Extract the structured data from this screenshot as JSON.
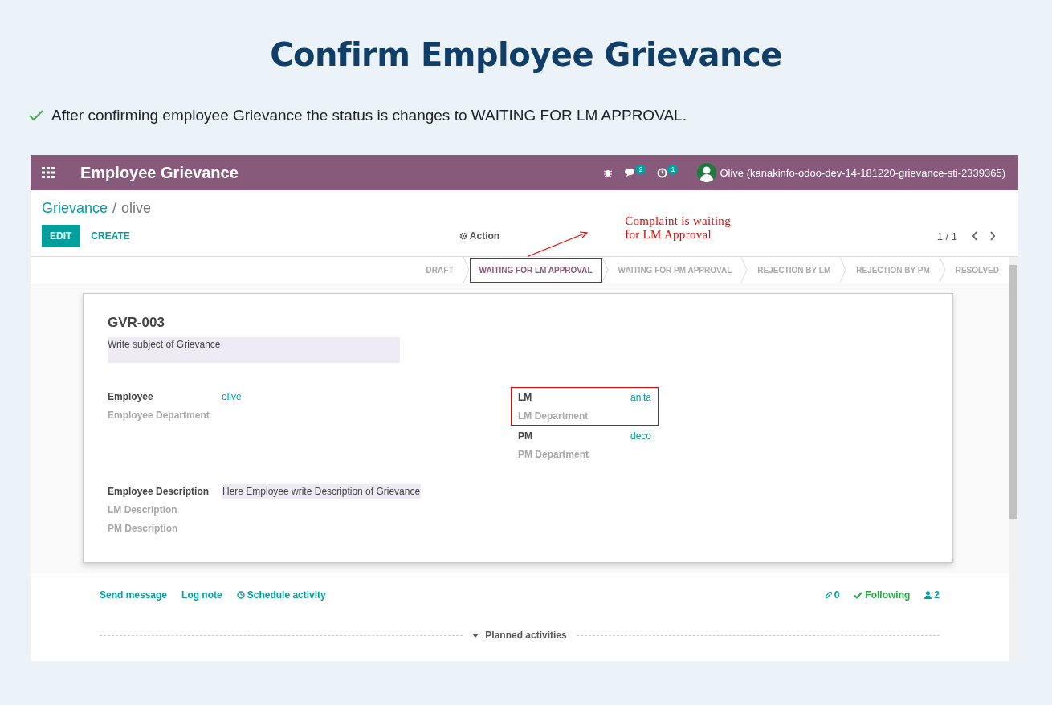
{
  "page_title": "Confirm Employee Grievance",
  "note": "After confirming employee Grievance the status is changes to WAITING FOR LM APPROVAL.",
  "app": {
    "title": "Employee Grievance",
    "messages_count": "2",
    "activities_count": "1",
    "user": "Olive (kanakinfo-odoo-dev-14-181220-grievance-sti-2339365)"
  },
  "breadcrumb": {
    "parent": "Grievance",
    "separator": "/",
    "current": "olive"
  },
  "buttons": {
    "edit": "EDIT",
    "create": "CREATE",
    "action": "Action"
  },
  "pager": "1 / 1",
  "callout": {
    "lines": [
      "Complaint is waiting",
      "for LM Approval"
    ]
  },
  "stages": [
    {
      "label": "DRAFT",
      "selected": false,
      "highlighted": false
    },
    {
      "label": "WAITING FOR LM APPROVAL",
      "selected": true,
      "highlighted": true
    },
    {
      "label": "WAITING FOR PM APPROVAL",
      "selected": false,
      "highlighted": false
    },
    {
      "label": "REJECTION BY LM",
      "selected": false,
      "highlighted": false
    },
    {
      "label": "REJECTION BY PM",
      "selected": false,
      "highlighted": false
    },
    {
      "label": "RESOLVED",
      "selected": false,
      "highlighted": false
    }
  ],
  "sheet": {
    "reference": "GVR-003",
    "subject": "Write subject of Grievance",
    "left_fields": [
      {
        "label": "Employee",
        "value": "olive"
      },
      {
        "label": "Employee Department"
      }
    ],
    "right_groups": [
      {
        "highlighted": true,
        "fields": [
          {
            "label": "LM",
            "value": "anita"
          },
          {
            "label": "LM Department"
          }
        ]
      },
      {
        "fields": [
          {
            "label": "PM",
            "value": "deco"
          },
          {
            "label": "PM Department"
          }
        ]
      }
    ],
    "descriptions": [
      {
        "label": "Employee Description",
        "value": "Here Employee write Description of Grievance"
      },
      {
        "label": "LM Description"
      },
      {
        "label": "PM Description"
      }
    ]
  },
  "chatter": {
    "send_message": "Send message",
    "log_note": "Log note",
    "schedule_activity": "Schedule activity",
    "attachments": "0",
    "following": "Following",
    "followers": "2",
    "planned_activities": "Planned activities"
  }
}
